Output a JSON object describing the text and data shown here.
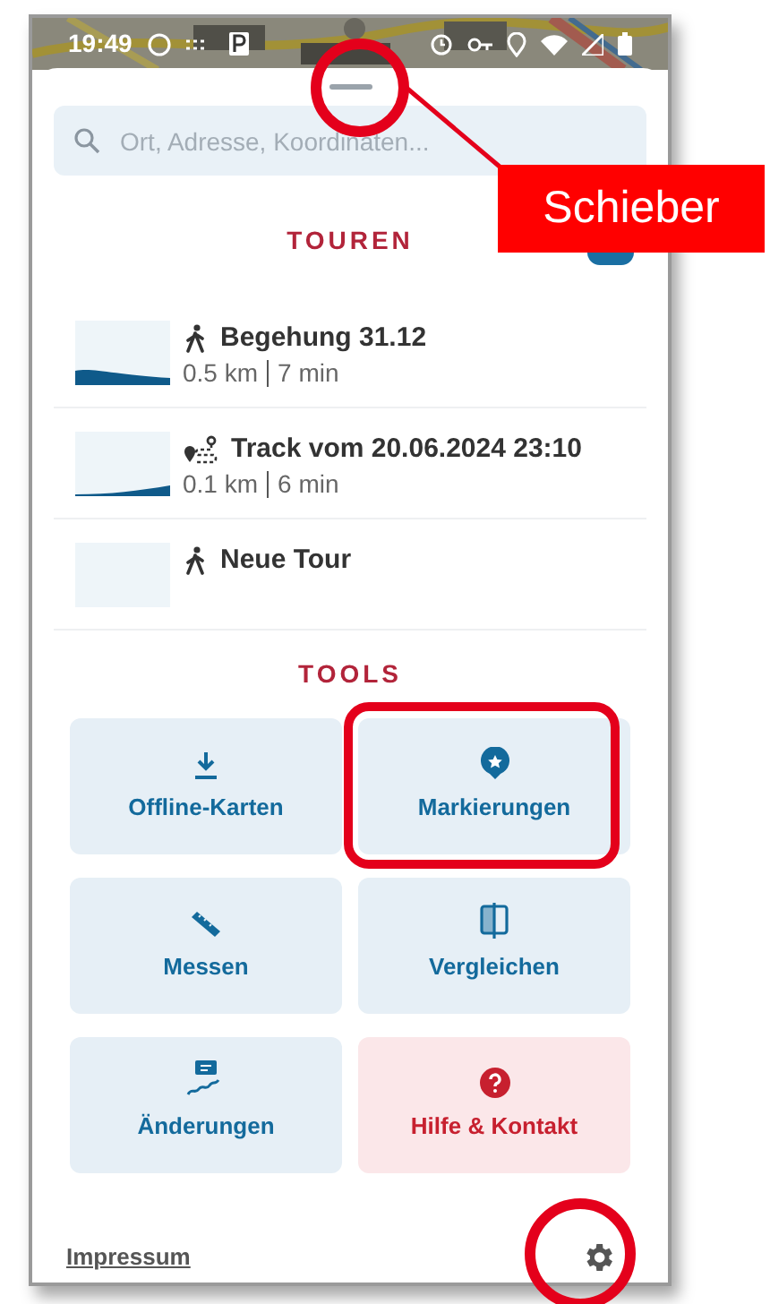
{
  "status_bar": {
    "time": "19:49"
  },
  "search": {
    "placeholder": "Ort, Adresse, Koordinaten..."
  },
  "tours": {
    "heading": "TOUREN",
    "items": [
      {
        "kind": "walk",
        "title": "Begehung 31.12",
        "distance": "0.5 km",
        "duration": "7 min"
      },
      {
        "kind": "track",
        "title": "Track vom 20.06.2024 23:10",
        "distance": "0.1 km",
        "duration": "6 min"
      },
      {
        "kind": "walk",
        "title": "Neue Tour"
      }
    ]
  },
  "tools": {
    "heading": "TOOLS",
    "items": [
      {
        "kind": "standard",
        "label": "Offline-Karten"
      },
      {
        "kind": "standard",
        "label": "Markierungen"
      },
      {
        "kind": "standard",
        "label": "Messen"
      },
      {
        "kind": "standard",
        "label": "Vergleichen"
      },
      {
        "kind": "standard",
        "label": "Änderungen"
      },
      {
        "kind": "help",
        "label": "Hilfe & Kontakt"
      }
    ]
  },
  "footer": {
    "link": "Impressum"
  },
  "annotations": {
    "callout": "Schieber"
  }
}
